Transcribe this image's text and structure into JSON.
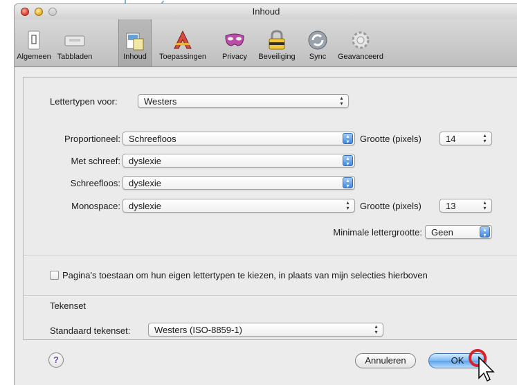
{
  "window": {
    "title": "Inhoud"
  },
  "toolbar": {
    "items": [
      {
        "label": "Algemeen",
        "icon": "switch-icon"
      },
      {
        "label": "Tabbladen",
        "icon": "tabs-icon"
      },
      {
        "label": "Inhoud",
        "icon": "content-icon",
        "selected": true
      },
      {
        "label": "Toepassingen",
        "icon": "applications-icon"
      },
      {
        "label": "Privacy",
        "icon": "mask-icon"
      },
      {
        "label": "Beveiliging",
        "icon": "lock-icon"
      },
      {
        "label": "Sync",
        "icon": "sync-icon"
      },
      {
        "label": "Geavanceerd",
        "icon": "gear-icon"
      }
    ]
  },
  "fonts": {
    "fonts_for_label": "Lettertypen voor:",
    "fonts_for_value": "Westers",
    "proportional_label": "Proportioneel:",
    "proportional_value": "Schreefloos",
    "size_label": "Grootte (pixels)",
    "proportional_size": "14",
    "serif_label": "Met schreef:",
    "serif_value": "dyslexie",
    "sans_label": "Schreefloos:",
    "sans_value": "dyslexie",
    "mono_label": "Monospace:",
    "mono_value": "dyslexie",
    "mono_size": "13",
    "min_size_label": "Minimale lettergrootte:",
    "min_size_value": "Geen"
  },
  "allow_pages": {
    "label": "Pagina's toestaan om hun eigen lettertypen te kiezen, in plaats van mijn selecties hierboven",
    "checked": false
  },
  "charset": {
    "section_label": "Tekenset",
    "default_label": "Standaard tekenset:",
    "default_value": "Westers (ISO-8859-1)"
  },
  "buttons": {
    "help": "?",
    "cancel": "Annuleren",
    "ok": "OK"
  },
  "colors": {
    "accent": "#3f87e0",
    "cursor_highlight": "#d8222a"
  }
}
